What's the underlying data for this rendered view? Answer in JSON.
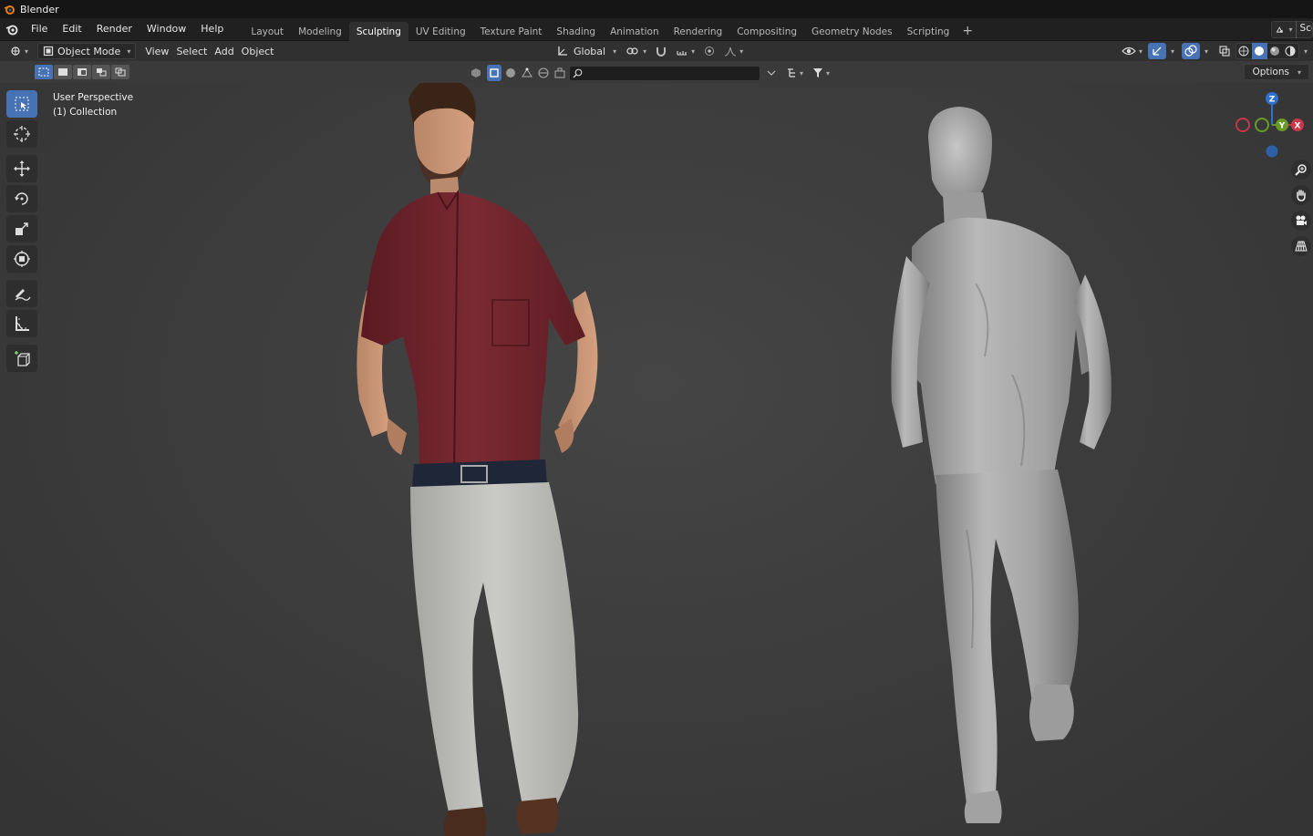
{
  "window": {
    "title": "Blender"
  },
  "menu": {
    "items": [
      "File",
      "Edit",
      "Render",
      "Window",
      "Help"
    ]
  },
  "workspaces": {
    "tabs": [
      "Layout",
      "Modeling",
      "Sculpting",
      "UV Editing",
      "Texture Paint",
      "Shading",
      "Animation",
      "Rendering",
      "Compositing",
      "Geometry Nodes",
      "Scripting"
    ],
    "active": "Sculpting",
    "add_label": "+"
  },
  "scene": {
    "label": "Sce"
  },
  "viewport_header": {
    "mode": "Object Mode",
    "menus": [
      "View",
      "Select",
      "Add",
      "Object"
    ],
    "orientation": "Global"
  },
  "tool_settings": {
    "options_label": "Options"
  },
  "viewport": {
    "perspective": "User Perspective",
    "collection": "(1) Collection"
  },
  "gizmo": {
    "z_label": "Z",
    "x_label": "X",
    "y_label": "Y"
  },
  "colors": {
    "accent": "#4772b3",
    "axis_x": "#c8374a",
    "axis_y": "#6a9a26",
    "axis_z": "#2f70cc",
    "shirt": "#6e242b",
    "pants": "#b9b9b6",
    "sculpt": "#a8a8a8"
  }
}
